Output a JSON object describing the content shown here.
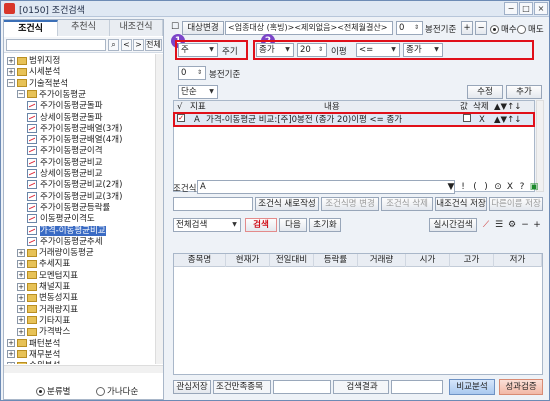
{
  "window": {
    "title": "[0150] 조건검색",
    "min": "−",
    "max": "□",
    "close": "×"
  },
  "left": {
    "tabs": [
      "조건식",
      "추천식",
      "내조건식"
    ],
    "search_value": "",
    "nav_prev": "<",
    "nav_next": ">",
    "all_button": "전체",
    "tree": [
      {
        "label": "범위지정",
        "level": 0,
        "exp": "+",
        "type": "folder"
      },
      {
        "label": "시세분석",
        "level": 0,
        "exp": "+",
        "type": "folder"
      },
      {
        "label": "기술적분석",
        "level": 0,
        "exp": "−",
        "type": "folder"
      },
      {
        "label": "주가이동평균",
        "level": 1,
        "exp": "−",
        "type": "folder"
      },
      {
        "label": "주가이동평균돌파",
        "level": 2,
        "exp": "",
        "type": "cond"
      },
      {
        "label": "상세이동평균돌파",
        "level": 2,
        "exp": "",
        "type": "cond"
      },
      {
        "label": "주가이동평균배열(3개)",
        "level": 2,
        "exp": "",
        "type": "cond"
      },
      {
        "label": "주가이동평균배열(4개)",
        "level": 2,
        "exp": "",
        "type": "cond"
      },
      {
        "label": "주가이동평균이격",
        "level": 2,
        "exp": "",
        "type": "cond"
      },
      {
        "label": "주가이동평균비교",
        "level": 2,
        "exp": "",
        "type": "cond"
      },
      {
        "label": "상세이동평균비교",
        "level": 2,
        "exp": "",
        "type": "cond"
      },
      {
        "label": "주가이동평균비교(2개)",
        "level": 2,
        "exp": "",
        "type": "cond"
      },
      {
        "label": "주가이동평균비교(3개)",
        "level": 2,
        "exp": "",
        "type": "cond"
      },
      {
        "label": "주가이동평균등락률",
        "level": 2,
        "exp": "",
        "type": "cond"
      },
      {
        "label": "이동평균이격도",
        "level": 2,
        "exp": "",
        "type": "cond"
      },
      {
        "label": "가격-이동평균비교",
        "level": 2,
        "exp": "",
        "type": "cond",
        "selected": true
      },
      {
        "label": "주가이동평균추세",
        "level": 2,
        "exp": "",
        "type": "cond"
      },
      {
        "label": "거래량이동평균",
        "level": 1,
        "exp": "+",
        "type": "folder"
      },
      {
        "label": "추세지표",
        "level": 1,
        "exp": "+",
        "type": "folder"
      },
      {
        "label": "모멘텀지표",
        "level": 1,
        "exp": "+",
        "type": "folder"
      },
      {
        "label": "채널지표",
        "level": 1,
        "exp": "+",
        "type": "folder"
      },
      {
        "label": "변동성지표",
        "level": 1,
        "exp": "+",
        "type": "folder"
      },
      {
        "label": "거래량지표",
        "level": 1,
        "exp": "+",
        "type": "folder"
      },
      {
        "label": "기타지표",
        "level": 1,
        "exp": "+",
        "type": "folder"
      },
      {
        "label": "가격박스",
        "level": 1,
        "exp": "+",
        "type": "folder"
      },
      {
        "label": "패턴분석",
        "level": 0,
        "exp": "+",
        "type": "folder"
      },
      {
        "label": "재무분석",
        "level": 0,
        "exp": "+",
        "type": "folder"
      },
      {
        "label": "순위분석",
        "level": 0,
        "exp": "+",
        "type": "folder"
      }
    ],
    "radio_1": "분류별",
    "radio_2": "가나다순"
  },
  "toolbar": {
    "target_change": "대상변경",
    "target_value": "<업종대상 (혹빙)><제외없음><전체월결산>",
    "num_value": "0",
    "base_label": "봉전기준",
    "plus": "+",
    "minus": "−",
    "radio_buy": "매수",
    "radio_sell": "매도"
  },
  "badges": {
    "one": "1",
    "two": "2"
  },
  "params": {
    "period": "주",
    "period_suffix": "주기",
    "offset": "0",
    "offset_label": "봉전기준",
    "price_type": "종가",
    "ma_period": "20",
    "ma_label": "이평",
    "operator": "<=",
    "compare": "종가",
    "mode": "단순"
  },
  "grid1": {
    "modify_button": "수정",
    "add_button": "추가",
    "headers": {
      "check": "√",
      "indicator": "지표",
      "content": "내용",
      "value": "값",
      "delete": "삭제"
    },
    "row": {
      "indicator": "A",
      "content": "가격-이동평균 비교:[주]0봉전 (종가 20)이평 <= 종가",
      "delete": "X",
      "arrows": "▲▼↑↓"
    }
  },
  "formula": {
    "label": "조건식",
    "value": "A",
    "ops": [
      "▼",
      "!",
      "(",
      ")",
      "⊙",
      "X",
      "?",
      "▣"
    ]
  },
  "actions": {
    "new": "조건식 새로작성",
    "change": "조건식명 변경",
    "delete": "조건식 삭제",
    "save": "내조건식 저장",
    "save_as": "다른이름 저장"
  },
  "search": {
    "scope": "전체검색",
    "search": "검색",
    "next": "다음",
    "reset": "초기화",
    "realtime": "실시간검색"
  },
  "grid2": {
    "headers": [
      "종목명",
      "현재가",
      "전일대비",
      "등락률",
      "거래량",
      "시가",
      "고가",
      "저가"
    ]
  },
  "bottom": {
    "interest_save": "관심저장",
    "match_label": "조건만족종목",
    "result_label": "검색결과",
    "compare": "비교분석",
    "verify": "성과검증"
  },
  "colors": {
    "accent": "#3b6fb6",
    "highlight": "#e0101a",
    "badge": "#7b44c8"
  }
}
